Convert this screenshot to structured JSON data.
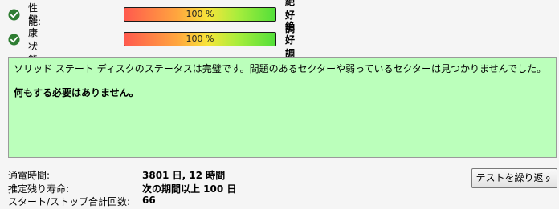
{
  "metrics": [
    {
      "label": "性能:",
      "percent_text": "100 %",
      "value": 100,
      "status": "絶好調",
      "icon": "check-circle-icon"
    },
    {
      "label": "健康状態:",
      "percent_text": "100 %",
      "value": 100,
      "status": "絶好調",
      "icon": "check-circle-icon"
    }
  ],
  "message": {
    "line1": "ソリッド ステート ディスクのステータスは完璧です。問題のあるセクターや弱っているセクターは見つかりませんでした。",
    "line2": "何もする必要はありません。"
  },
  "info": [
    {
      "label": "通電時間:",
      "value": "3801 日, 12 時間"
    },
    {
      "label": "推定残り寿命:",
      "value": "次の期間以上 100 日"
    },
    {
      "label": "スタート/ストップ合計回数:",
      "value": "66"
    }
  ],
  "retest_button": "テストを繰り返す",
  "colors": {
    "check_icon": "#2e7d32",
    "message_background": "#bbffbb",
    "bar_gradient": [
      "#ff5a4e",
      "#ffa63e",
      "#f8e53a",
      "#a8ed3c",
      "#52df3a"
    ]
  }
}
